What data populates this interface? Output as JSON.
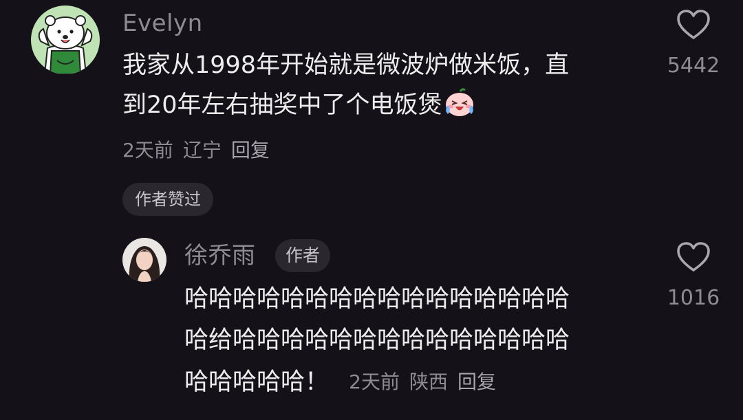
{
  "comment": {
    "username": "Evelyn",
    "text_line1": "我家从1998年开始就是微波炉做米饭，直",
    "text_line2": "到20年左右抽奖中了个电饭煲",
    "emoji_icon": "crying-laughing-face-icon",
    "time": "2天前",
    "location": "辽宁",
    "reply_label": "回复",
    "author_liked_badge": "作者赞过",
    "like_count": "5442"
  },
  "reply": {
    "username": "徐乔雨",
    "author_tag": "作者",
    "text_line1": "哈哈哈哈哈哈哈哈哈哈哈哈哈哈哈哈",
    "text_line2": "哈给哈哈哈哈哈哈哈哈哈哈哈哈哈哈",
    "text_line3": "哈哈哈哈哈！",
    "time": "2天前",
    "location": "陕西",
    "reply_label": "回复",
    "like_count": "1016"
  },
  "colors": {
    "background": "#141218",
    "primary_text": "#ededed",
    "secondary_text": "#8e8b93",
    "pill_background": "#2a282e"
  }
}
